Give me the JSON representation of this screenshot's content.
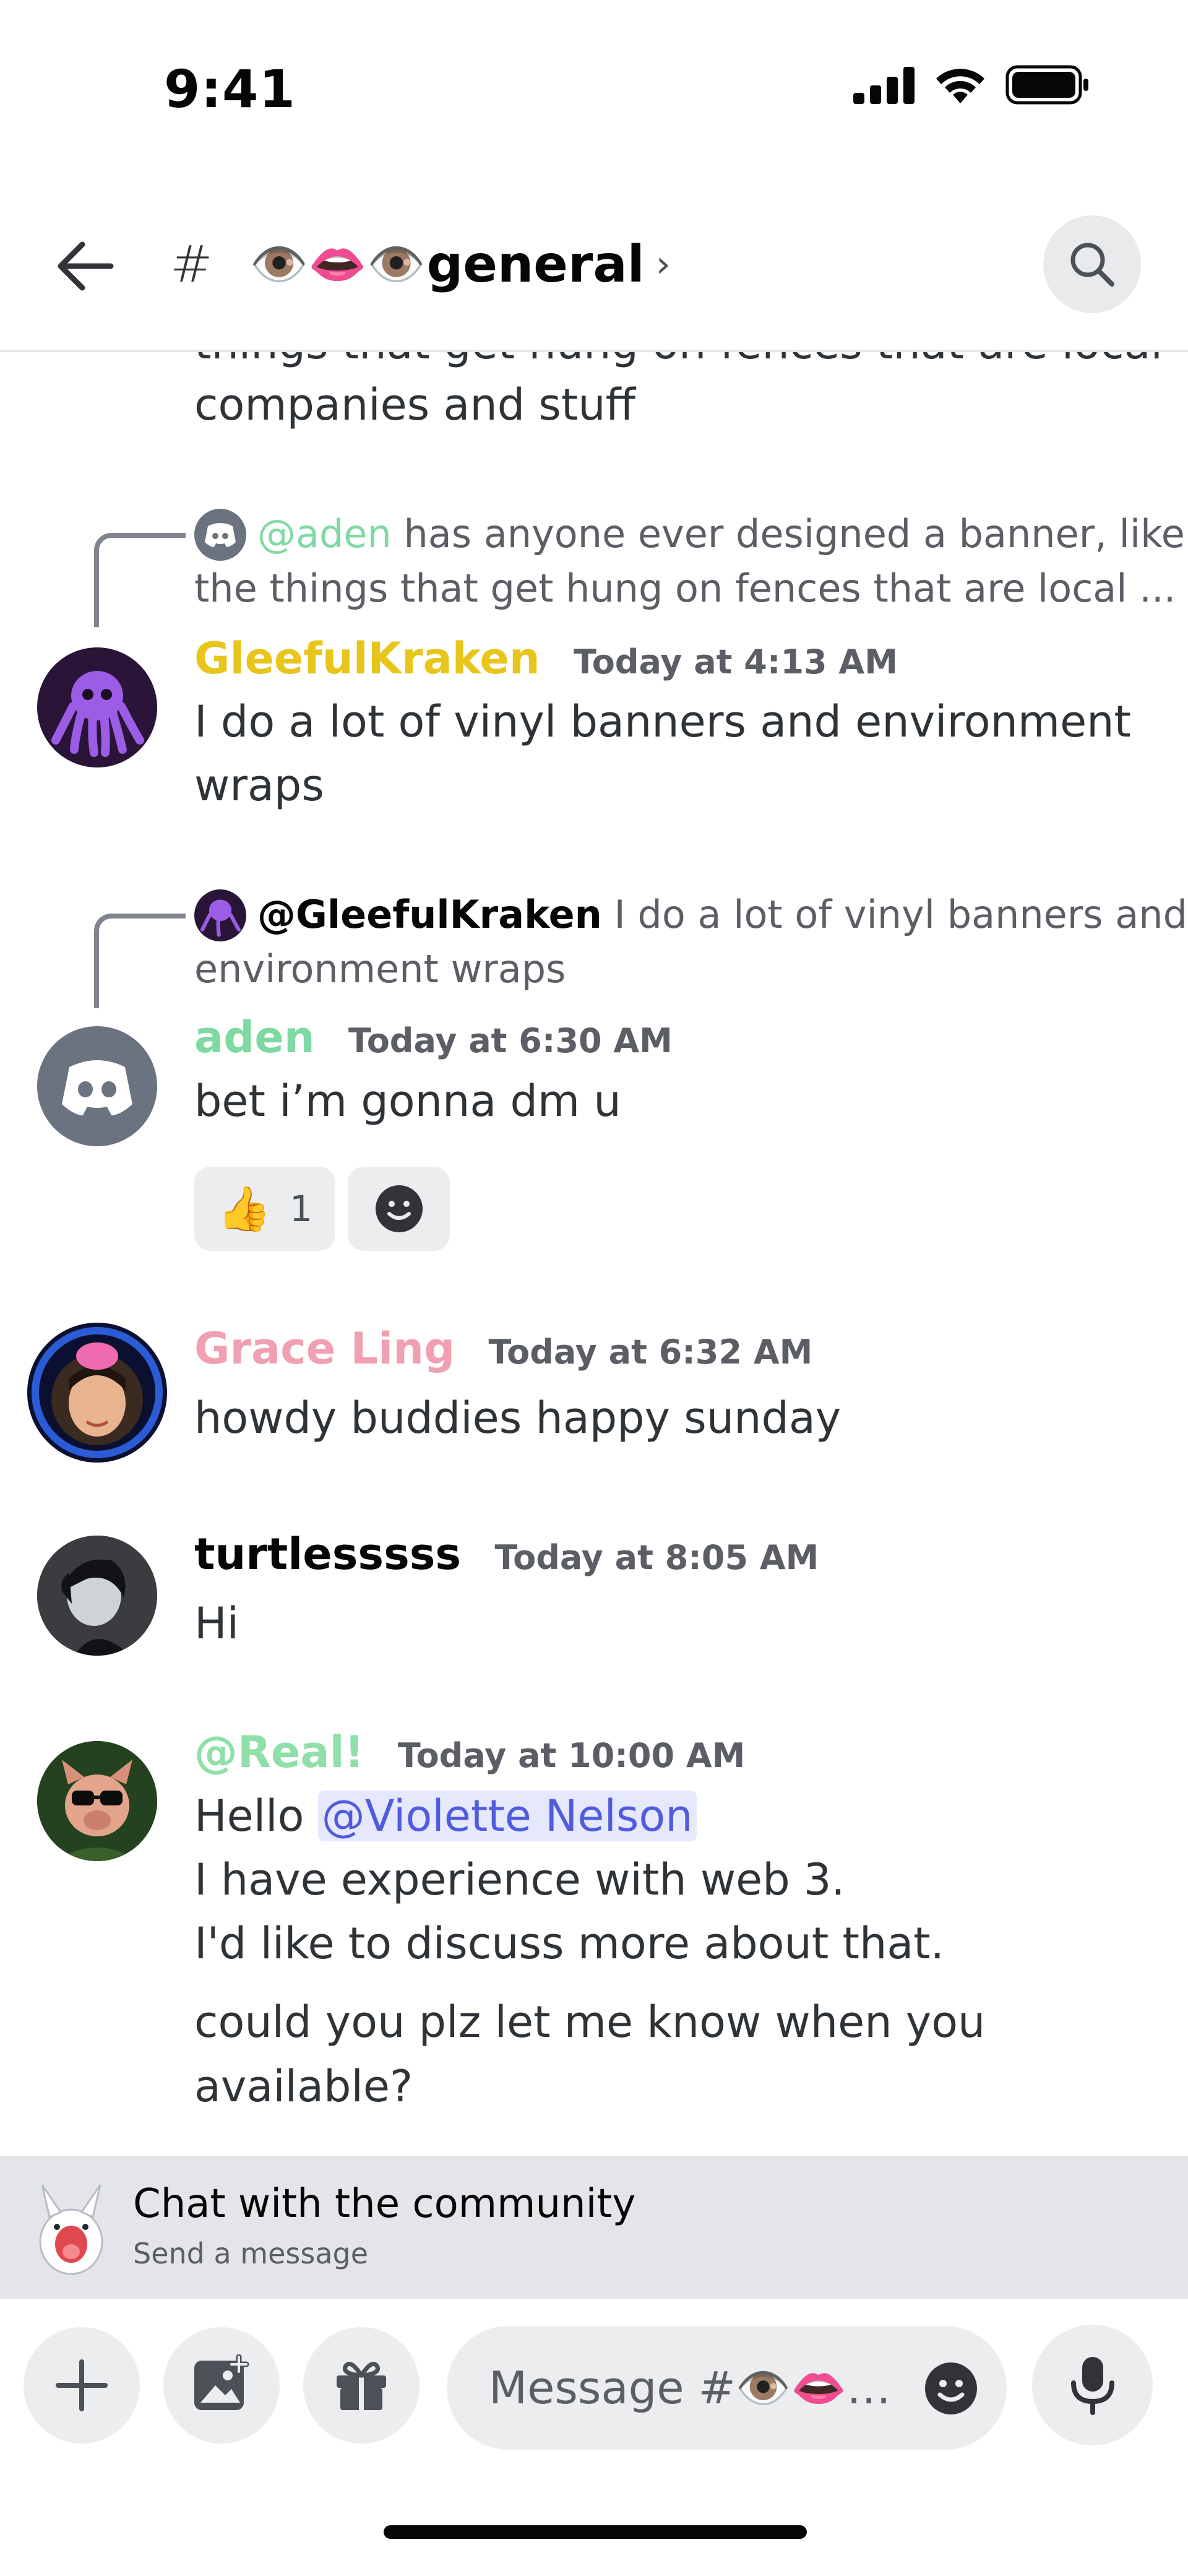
{
  "status_bar": {
    "time": "9:41"
  },
  "header": {
    "hash": "#",
    "channel_emoji": "👁️👄👁️",
    "channel_name": "general",
    "chevron": "›"
  },
  "messages": {
    "cut_off_text_top": "things that get hung on fences that are local",
    "cut_off_text_bottom": "companies and stuff",
    "msg1": {
      "reply_author": "@aden",
      "reply_text_1": "has anyone ever designed a banner, like",
      "reply_text_2": "the things that get hung on fences that are local ...",
      "author": "GleefulKraken",
      "author_color": "#e8c51b",
      "timestamp": "Today at 4:13 AM",
      "line1": "I do a lot of vinyl banners and environment",
      "line2": "wraps"
    },
    "msg2": {
      "reply_author": "@GleefulKraken",
      "reply_text_1": "I do a lot of vinyl banners and",
      "reply_text_2": "environment wraps",
      "author": "aden",
      "author_color": "#7fd9a2",
      "timestamp": "Today at 6:30 AM",
      "line1": "bet i’m gonna dm u",
      "reaction_emoji": "👍",
      "reaction_count": "1"
    },
    "msg3": {
      "author": "Grace Ling",
      "author_color": "#f0a0b0",
      "timestamp": "Today at 6:32 AM",
      "line1": "howdy buddies happy sunday"
    },
    "msg4": {
      "author": "turtlesssss",
      "author_color": "#060607",
      "timestamp": "Today at 8:05 AM",
      "line1": "Hi"
    },
    "msg5": {
      "author": "@Real!",
      "author_color": "#8fe0a8",
      "timestamp": "Today at 10:00 AM",
      "line1_prefix": "Hello",
      "mention": "@Violette Nelson",
      "line2": "I have experience with web 3.",
      "line3": "I'd like to discuss more about that.",
      "line4": "could you plz let me know when you available?"
    }
  },
  "community_banner": {
    "title": "Chat with the community",
    "subtitle": "Send a message"
  },
  "composer": {
    "placeholder": "Message #👁️👄…"
  },
  "colors": {
    "accent": "#5865f2",
    "mention_bg": "#e6e8fd",
    "mention_fg": "#505cdc"
  }
}
